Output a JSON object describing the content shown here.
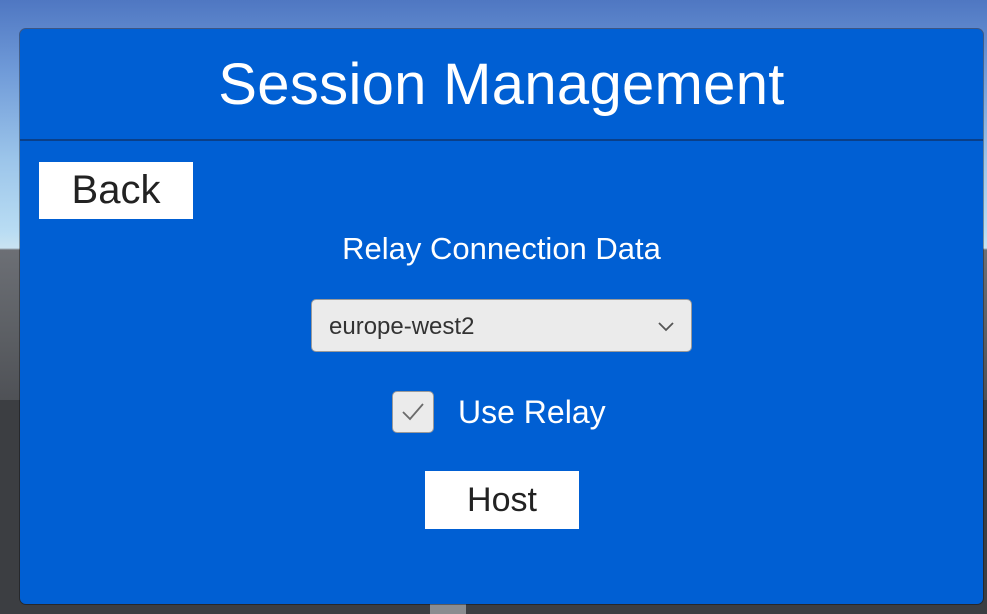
{
  "panel": {
    "title": "Session Management"
  },
  "back_button": {
    "label": "Back"
  },
  "relay": {
    "section_label": "Relay Connection Data",
    "region_dropdown": {
      "selected": "europe-west2",
      "icon": "chevron-down-icon"
    },
    "use_relay": {
      "label": "Use Relay",
      "checked": true,
      "icon": "checkmark-icon"
    }
  },
  "host_button": {
    "label": "Host"
  },
  "colors": {
    "panel_background": "#005fd3",
    "button_background": "#ffffff",
    "control_background": "#ebebeb"
  }
}
